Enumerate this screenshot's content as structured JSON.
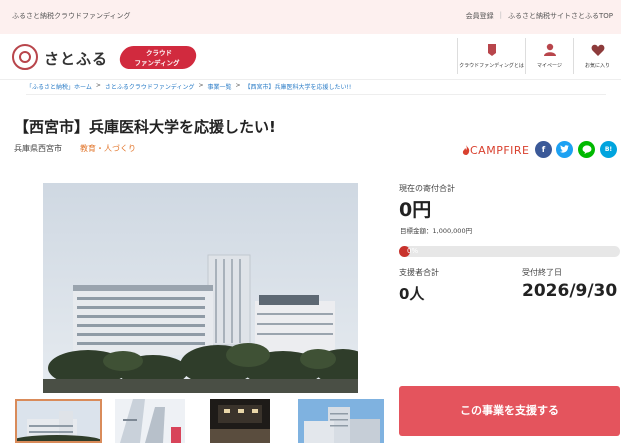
{
  "topbar": {
    "site_label": "ふるさと納税クラウドファンディング",
    "links": [
      "会員登録",
      "ふるさと納税サイトさとふるTOP"
    ]
  },
  "header": {
    "logo_text": "さとふる",
    "badge_line1": "クラウド",
    "badge_line2": "ファンディング",
    "badge_color": "#d12a3e",
    "nav": [
      {
        "label": "クラウドファンディングとは",
        "icon": "crowdfunding-icon"
      },
      {
        "label": "マイページ",
        "icon": "user-icon"
      },
      {
        "label": "お気に入り",
        "icon": "heart-icon"
      }
    ]
  },
  "breadcrumb": {
    "items": [
      "「ふるさと納税」ホーム",
      "さとふるクラウドファンディング",
      "事業一覧",
      "【西宮市】兵庫医科大学を応援したい!!"
    ],
    "separator": ">"
  },
  "project": {
    "title": "【西宮市】兵庫医科大学を応援したい!",
    "location": "兵庫県西宮市",
    "category": "教育・人づくり",
    "platform": "CAMPFIRE",
    "share_icons": [
      "facebook-icon",
      "twitter-icon",
      "line-icon",
      "hatena-icon"
    ]
  },
  "stats": {
    "donation_label": "現在の寄付合計",
    "donation_value": "0円",
    "target_label": "目標金額：1,000,000円",
    "progress_percent": 0,
    "progress_text": "0%",
    "supporters_label": "支援者合計",
    "supporters_value": "0人",
    "deadline_label": "受付終了日",
    "deadline_value": "2026/9/30"
  },
  "cta": {
    "support_label": "この事業を支援する"
  },
  "colors": {
    "accent": "#e4545d",
    "progress": "#c8322c",
    "link": "#2a7cc7",
    "category": "#e2762c"
  }
}
